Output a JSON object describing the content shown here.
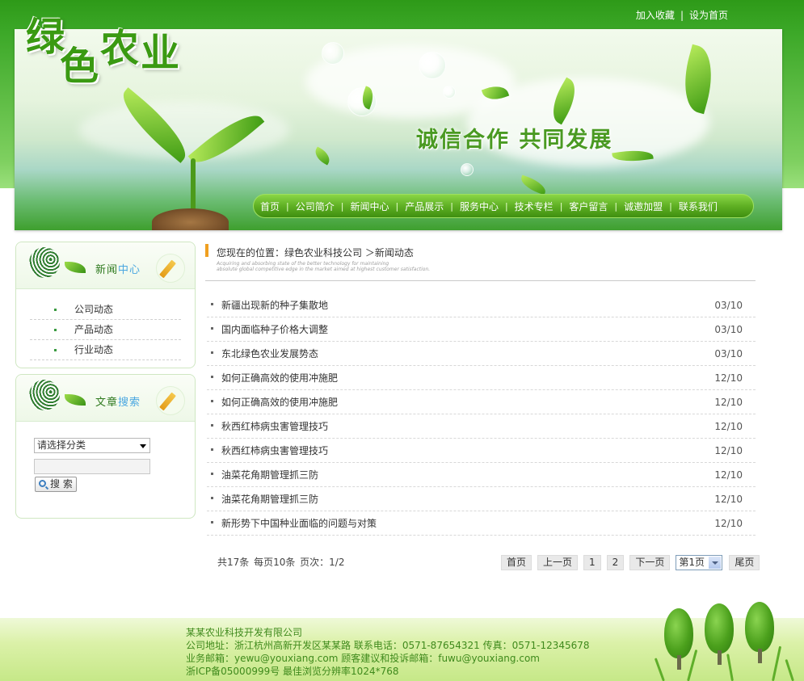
{
  "header": {
    "logo_chars": [
      "绿",
      "色",
      "农",
      "业"
    ],
    "top_links": [
      "加入收藏",
      "设为首页"
    ],
    "slogan": "诚信合作  共同发展",
    "nav": [
      "首页",
      "公司简介",
      "新闻中心",
      "产品展示",
      "服务中心",
      "技术专栏",
      "客户留言",
      "诚邀加盟",
      "联系我们"
    ]
  },
  "sidebar": {
    "news_box": {
      "title_a": "新闻",
      "title_b": "中心",
      "categories": [
        "公司动态",
        "产品动态",
        "行业动态"
      ]
    },
    "search_box": {
      "title_a": "文章",
      "title_b": "搜索",
      "select_value": "请选择分类",
      "button_label": "搜 索"
    }
  },
  "main": {
    "breadcrumb": "您现在的位置：绿色农业科技公司 ＞新闻动态",
    "breadcrumb_sub": [
      "Acquiring and absorbing state of the better technology for maintaining",
      "absolute global competitive edge in the market aimed at highest customer satisfaction."
    ],
    "news": [
      {
        "title": "新疆出现新的种子集散地",
        "date": "03/10"
      },
      {
        "title": "国内面临种子价格大调整",
        "date": "03/10"
      },
      {
        "title": "东北绿色农业发展势态",
        "date": "03/10"
      },
      {
        "title": "如何正确高效的使用冲施肥",
        "date": "12/10"
      },
      {
        "title": "如何正确高效的使用冲施肥",
        "date": "12/10"
      },
      {
        "title": "秋西红柿病虫害管理技巧",
        "date": "12/10"
      },
      {
        "title": "秋西红柿病虫害管理技巧",
        "date": "12/10"
      },
      {
        "title": "油菜花角期管理抓三防",
        "date": "12/10"
      },
      {
        "title": "油菜花角期管理抓三防",
        "date": "12/10"
      },
      {
        "title": "新形势下中国种业面临的问题与对策",
        "date": "12/10"
      }
    ],
    "pagination": {
      "info": "共17条  每页10条  页次：1/2",
      "first": "首页",
      "prev": "上一页",
      "pages": [
        "1",
        "2"
      ],
      "next": "下一页",
      "select_value": "第1页",
      "last": "尾页"
    }
  },
  "footer": {
    "lines": [
      "某某农业科技开发有限公司",
      "公司地址：浙江杭州高新开发区某某路  联系电话：0571-87654321   传真：0571-12345678",
      "业务邮箱：yewu@youxiang.com   顾客建议和投诉邮箱：fuwu@youxiang.com",
      "浙ICP备05000999号  最佳浏览分辨率1024*768"
    ]
  },
  "colors": {
    "brand_green": "#3ca828",
    "accent_orange": "#f0a020",
    "footer_text": "#3f8a1c"
  }
}
